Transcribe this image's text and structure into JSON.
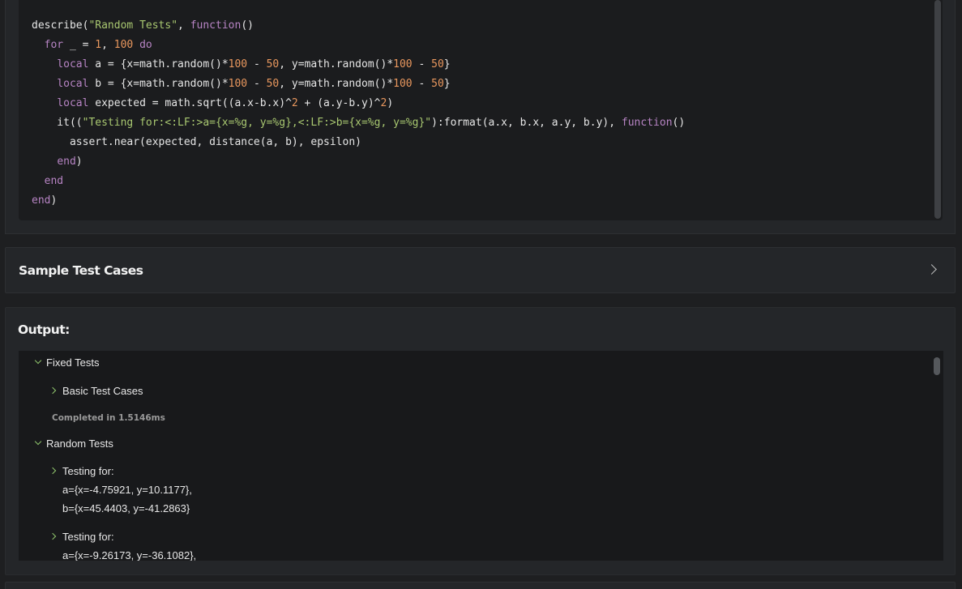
{
  "code": {
    "lines": [
      [
        {
          "t": "describe(",
          "c": "id"
        },
        {
          "t": "\"Random Tests\"",
          "c": "str"
        },
        {
          "t": ", ",
          "c": "id"
        },
        {
          "t": "function",
          "c": "kw"
        },
        {
          "t": "()",
          "c": "id"
        }
      ],
      [
        {
          "t": "  ",
          "c": "id"
        },
        {
          "t": "for",
          "c": "kw"
        },
        {
          "t": " _ = ",
          "c": "id"
        },
        {
          "t": "1",
          "c": "num"
        },
        {
          "t": ", ",
          "c": "id"
        },
        {
          "t": "100",
          "c": "num"
        },
        {
          "t": " ",
          "c": "id"
        },
        {
          "t": "do",
          "c": "kw"
        }
      ],
      [
        {
          "t": "    ",
          "c": "id"
        },
        {
          "t": "local",
          "c": "kw"
        },
        {
          "t": " a = {x=math.random()*",
          "c": "id"
        },
        {
          "t": "100",
          "c": "num"
        },
        {
          "t": " - ",
          "c": "id"
        },
        {
          "t": "50",
          "c": "num"
        },
        {
          "t": ", y=math.random()*",
          "c": "id"
        },
        {
          "t": "100",
          "c": "num"
        },
        {
          "t": " - ",
          "c": "id"
        },
        {
          "t": "50",
          "c": "num"
        },
        {
          "t": "}",
          "c": "id"
        }
      ],
      [
        {
          "t": "    ",
          "c": "id"
        },
        {
          "t": "local",
          "c": "kw"
        },
        {
          "t": " b = {x=math.random()*",
          "c": "id"
        },
        {
          "t": "100",
          "c": "num"
        },
        {
          "t": " - ",
          "c": "id"
        },
        {
          "t": "50",
          "c": "num"
        },
        {
          "t": ", y=math.random()*",
          "c": "id"
        },
        {
          "t": "100",
          "c": "num"
        },
        {
          "t": " - ",
          "c": "id"
        },
        {
          "t": "50",
          "c": "num"
        },
        {
          "t": "}",
          "c": "id"
        }
      ],
      [
        {
          "t": "    ",
          "c": "id"
        },
        {
          "t": "local",
          "c": "kw"
        },
        {
          "t": " expected = math.sqrt((a.x-b.x)^",
          "c": "id"
        },
        {
          "t": "2",
          "c": "num"
        },
        {
          "t": " + (a.y-b.y)^",
          "c": "id"
        },
        {
          "t": "2",
          "c": "num"
        },
        {
          "t": ")",
          "c": "id"
        }
      ],
      [
        {
          "t": "    it((",
          "c": "id"
        },
        {
          "t": "\"Testing for:<:LF:>a={x=%g, y=%g},<:LF:>b={x=%g, y=%g}\"",
          "c": "str"
        },
        {
          "t": "):format(a.x, b.x, a.y, b.y), ",
          "c": "id"
        },
        {
          "t": "function",
          "c": "kw"
        },
        {
          "t": "()",
          "c": "id"
        }
      ],
      [
        {
          "t": "      assert.near(expected, distance(a, b), epsilon)",
          "c": "id"
        }
      ],
      [
        {
          "t": "    ",
          "c": "id"
        },
        {
          "t": "end",
          "c": "kw"
        },
        {
          "t": ")",
          "c": "id"
        }
      ],
      [
        {
          "t": "  ",
          "c": "id"
        },
        {
          "t": "end",
          "c": "kw"
        }
      ],
      [
        {
          "t": "end",
          "c": "kw"
        },
        {
          "t": ")",
          "c": "id"
        }
      ]
    ]
  },
  "sample": {
    "title": "Sample Test Cases"
  },
  "output": {
    "title": "Output:",
    "fixed_tests": "Fixed Tests",
    "basic_test_cases": "Basic Test Cases",
    "completed": "Completed in 1.5146ms",
    "random_tests": "Random Tests",
    "test1": {
      "label": "Testing for:",
      "a": "a={x=-4.75921, y=10.1177},",
      "b": "b={x=45.4403, y=-41.2863}"
    },
    "test2": {
      "label": "Testing for:",
      "a": "a={x=-9.26173, y=-36.1082},"
    }
  },
  "colors": {
    "keyword": "#b784c4",
    "string": "#a8c770",
    "number": "#e8975e",
    "chevron": "#8dc26b"
  }
}
